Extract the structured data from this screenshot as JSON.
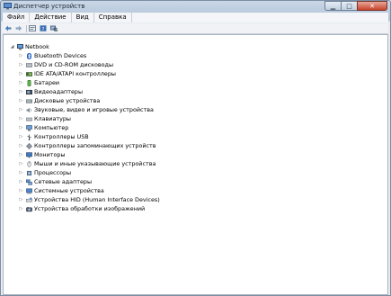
{
  "window": {
    "title": "Диспетчер устройств"
  },
  "menu": [
    "Файл",
    "Действие",
    "Вид",
    "Справка"
  ],
  "toolbar": [
    "back-icon",
    "forward-icon",
    "properties-icon",
    "help-icon",
    "scan-hardware-icon"
  ],
  "tree": {
    "root": "Netbook",
    "categories": [
      {
        "label": "Bluetooth Devices",
        "icon": "bluetooth-icon"
      },
      {
        "label": "DVD и CD-ROM дисководы",
        "icon": "dvd-drive-icon"
      },
      {
        "label": "IDE ATA/ATAPI контроллеры",
        "icon": "ide-controller-icon"
      },
      {
        "label": "Батареи",
        "icon": "battery-icon"
      },
      {
        "label": "Видеоадаптеры",
        "icon": "display-adapter-icon"
      },
      {
        "label": "Дисковые устройства",
        "icon": "disk-drive-icon"
      },
      {
        "label": "Звуковые, видео и игровые устройства",
        "icon": "sound-icon"
      },
      {
        "label": "Клавиатуры",
        "icon": "keyboard-icon"
      },
      {
        "label": "Компьютер",
        "icon": "computer-icon"
      },
      {
        "label": "Контроллеры USB",
        "icon": "usb-icon"
      },
      {
        "label": "Контроллеры запоминающих устройств",
        "icon": "storage-controller-icon"
      },
      {
        "label": "Мониторы",
        "icon": "monitor-icon"
      },
      {
        "label": "Мыши и иные указывающие устройства",
        "icon": "mouse-icon"
      },
      {
        "label": "Процессоры",
        "icon": "processor-icon"
      },
      {
        "label": "Сетевые адаптеры",
        "icon": "network-adapter-icon"
      },
      {
        "label": "Системные устройства",
        "icon": "system-device-icon"
      },
      {
        "label": "Устройства HID (Human Interface Devices)",
        "icon": "hid-icon"
      },
      {
        "label": "Устройства обработки изображений",
        "icon": "imaging-device-icon"
      }
    ]
  }
}
